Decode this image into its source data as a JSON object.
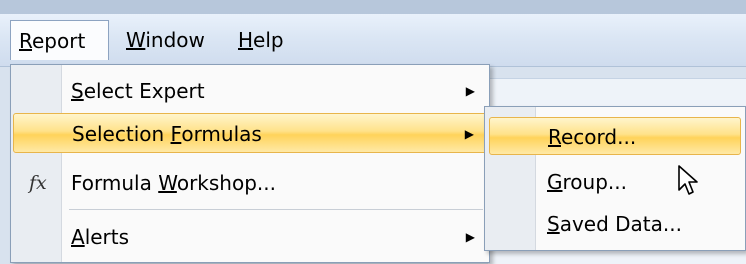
{
  "menubar": {
    "items": [
      {
        "label": "Report",
        "mnemonic": "R",
        "rest": "eport"
      },
      {
        "label": "Window",
        "mnemonic": "W",
        "rest": "indow"
      },
      {
        "label": "Help",
        "mnemonic": "H",
        "rest": "elp"
      }
    ]
  },
  "report_menu": {
    "items": [
      {
        "label": "Select Expert",
        "pre": "",
        "mnemonic": "S",
        "post": "elect Expert",
        "submenu": true
      },
      {
        "label": "Selection Formulas",
        "pre": "Selection ",
        "mnemonic": "F",
        "post": "ormulas",
        "submenu": true,
        "highlighted": true
      },
      {
        "label": "Formula Workshop...",
        "pre": "Formula ",
        "mnemonic": "W",
        "post": "orkshop...",
        "icon": "fx-icon",
        "icon_text": "fx"
      },
      {
        "label": "Alerts",
        "pre": "",
        "mnemonic": "A",
        "post": "lerts",
        "submenu": true
      }
    ]
  },
  "selection_formulas_submenu": {
    "items": [
      {
        "label": "Record...",
        "mnemonic": "R",
        "post": "ecord...",
        "highlighted": true
      },
      {
        "label": "Group...",
        "mnemonic": "G",
        "post": "roup..."
      },
      {
        "label": "Saved Data...",
        "mnemonic": "S",
        "post": "aved Data..."
      }
    ]
  },
  "icons": {
    "submenu_arrow": "triangle-right-icon",
    "cursor": "mouse-pointer-icon"
  },
  "colors": {
    "highlight_top": "#fff5cc",
    "highlight_mid": "#ffd35a",
    "highlight_border": "#e8b54b"
  }
}
